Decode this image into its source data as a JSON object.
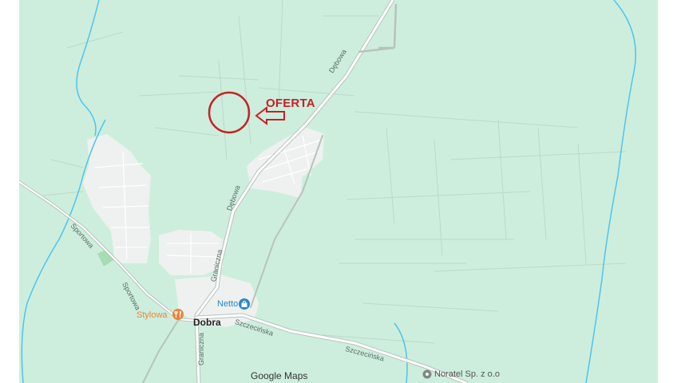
{
  "map": {
    "attribution": "Google Maps",
    "overlay_label": "OFERTA",
    "places": {
      "town": "Dobra",
      "supermarket": "Netto",
      "restaurant": "Stylowa",
      "company": "Noratel Sp. z o.o"
    },
    "streets": {
      "debowa_north": "Dębowa",
      "debowa_south": "Dębowa",
      "graniczna_north": "Graniczna",
      "graniczna_south": "Graniczna",
      "sportowa_west": "Sportowa",
      "sportowa_south": "Sportowa",
      "szczecinska_west": "Szczecińska",
      "szczecinska_east": "Szczecińska"
    },
    "colors": {
      "land": "#cdeedd",
      "water": "#4fc3ec",
      "built_up": "#eef1ef",
      "road_main": "#b7c3bc",
      "road_minor": "#ffffff",
      "park": "#a7dcb4",
      "annotation": "#c62026",
      "poi_orange": "#e8853a",
      "poi_blue": "#2a86c7"
    },
    "icons": [
      "restaurant-icon",
      "shopping-bag-icon",
      "map-pin-icon"
    ]
  }
}
